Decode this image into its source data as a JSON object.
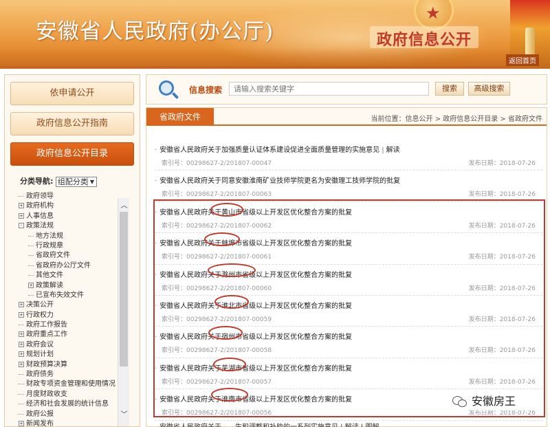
{
  "header": {
    "site_title": "安徽省人民政府(办公厅)",
    "badge": "政府信息公开",
    "back_home": "返回首页"
  },
  "sidebar": {
    "buttons": [
      "依申请公开",
      "政府信息公开指南",
      "政府信息公开目录"
    ],
    "category_label": "分类导航:",
    "category_value": "组配分类",
    "tree": [
      {
        "label": "政府领导",
        "toggle": ""
      },
      {
        "label": "政府机构",
        "toggle": "+"
      },
      {
        "label": "人事信息",
        "toggle": "+"
      },
      {
        "label": "政策法规",
        "toggle": "-"
      },
      {
        "label": "地方法规",
        "toggle": "",
        "indent": 1
      },
      {
        "label": "行政规章",
        "toggle": "",
        "indent": 1
      },
      {
        "label": "省政府文件",
        "toggle": "",
        "indent": 1
      },
      {
        "label": "省政府办公厅文件",
        "toggle": "",
        "indent": 1
      },
      {
        "label": "其他文件",
        "toggle": "",
        "indent": 1
      },
      {
        "label": "政策解读",
        "toggle": "+",
        "indent": 1
      },
      {
        "label": "已宣布失效文件",
        "toggle": "",
        "indent": 1
      },
      {
        "label": "决策公开",
        "toggle": "+"
      },
      {
        "label": "行政权力",
        "toggle": "+"
      },
      {
        "label": "政府工作报告",
        "toggle": ""
      },
      {
        "label": "政府重点工作",
        "toggle": "+"
      },
      {
        "label": "政府会议",
        "toggle": "+"
      },
      {
        "label": "规划计划",
        "toggle": "+"
      },
      {
        "label": "财政预算决算",
        "toggle": "+"
      },
      {
        "label": "政府债务",
        "toggle": ""
      },
      {
        "label": "财政专项资金管理和使用情况",
        "toggle": ""
      },
      {
        "label": "月度财政收支",
        "toggle": ""
      },
      {
        "label": "经济和社会发展的统计信息",
        "toggle": ""
      },
      {
        "label": "政府公报",
        "toggle": ""
      },
      {
        "label": "新闻发布",
        "toggle": "+"
      }
    ]
  },
  "search": {
    "label": "信息搜索",
    "placeholder": "请输入搜索关键字",
    "search_button": "搜索",
    "advanced_button": "高级搜索"
  },
  "main": {
    "tab": "省政府文件",
    "breadcrumb": "当前位置：信息公开 > 政府信息公开目录 > 省政府文件",
    "entries": [
      {
        "title": "安徽省人民政府关于加强质量认证体系建设促进全面质量管理的实施意见",
        "extra": "解读",
        "index": "索引号：00298627-2/201807-00047",
        "date": "发布日期：2018-07-26"
      },
      {
        "title": "安徽省人民政府关于同意安徽淮南矿业技师学院更名为安徽理工技师学院的批复",
        "extra": "",
        "index": "索引号：00298627-2/201807-00063",
        "date": "发布日期：2018-07-26"
      },
      {
        "title": "安徽省人民政府关于黄山市省级以上开发区优化整合方案的批复",
        "extra": "",
        "index": "索引号：00298627-2/201807-00062",
        "date": "发布日期：2018-07-26"
      },
      {
        "title": "安徽省人民政府关于蚌埠市省级以上开发区优化整合方案的批复",
        "extra": "",
        "index": "索引号：00298627-2/201807-00061",
        "date": "发布日期：2018-07-26"
      },
      {
        "title": "安徽省人民政府关于滁州市省级以上开发区优化整合方案的批复",
        "extra": "",
        "index": "索引号：00298627-2/201807-00060",
        "date": "发布日期：2018-07-26"
      },
      {
        "title": "安徽省人民政府关于淮北市省级以上开发区优化整合方案的批复",
        "extra": "",
        "index": "索引号：00298627-2/201807-00059",
        "date": "发布日期：2018-07-26"
      },
      {
        "title": "安徽省人民政府关于宿州市省级以上开发区优化整合方案的批复",
        "extra": "",
        "index": "索引号：00298627-2/201807-00058",
        "date": "发布日期：2018-07-26"
      },
      {
        "title": "安徽省人民政府关于芜湖市省级以上开发区优化整合方案的批复",
        "extra": "",
        "index": "索引号：00298627-2/201807-00057",
        "date": "发布日期：2018-07-26"
      },
      {
        "title": "安徽省人民政府关于淮南市省级以上开发区优化整合方案的批复",
        "extra": "",
        "index": "索引号：00298627-2/201807-00056",
        "date": "发布日期：2018-07-26"
      }
    ],
    "partial_row": "安徽省人民政府关于……生和调整和补助的一系列实施意见   |  解读  |  图解"
  },
  "watermark": "安徽房王",
  "colors": {
    "accent": "#d9661c",
    "highlight": "#c0392b"
  }
}
